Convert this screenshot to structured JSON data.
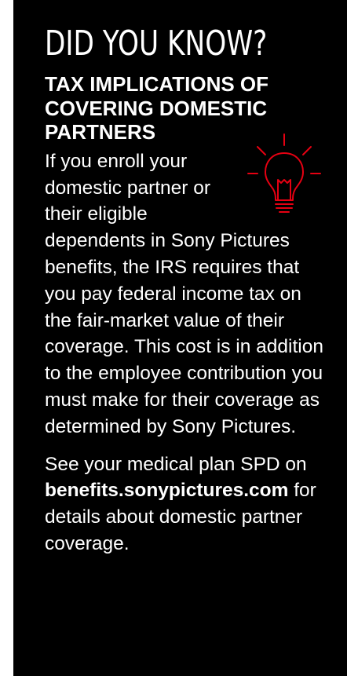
{
  "card": {
    "eyebrow": "DID YOU KNOW?",
    "headline": "TAX IMPLICATIONS OF COVERING DOMESTIC PARTNERS",
    "paragraph_1": "If you enroll your domestic partner or their eligible dependents in Sony Pictures benefits, the IRS requires that you pay federal income tax on the fair-market value of their coverage. This cost is in addition to the employee contribution you must make for their coverage as determined by Sony Pictures.",
    "paragraph_2_prefix": "See your medical plan SPD on",
    "paragraph_2_link": "benefits.sonypictures.com",
    "paragraph_2_suffix": "for details about domestic partner coverage.",
    "icon": "lightbulb-icon",
    "accent_color": "#e60012",
    "background_color": "#000000",
    "text_color": "#ffffff"
  }
}
